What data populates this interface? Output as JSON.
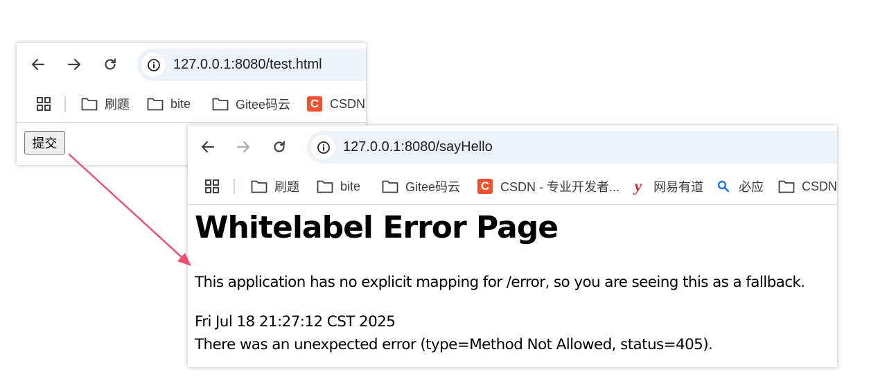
{
  "window_back": {
    "url": "127.0.0.1:8080/test.html",
    "bookmarks": [
      {
        "label": "刷题",
        "icon": "folder-icon"
      },
      {
        "label": "bite",
        "icon": "folder-icon"
      },
      {
        "label": "Gitee码云",
        "icon": "folder-icon"
      },
      {
        "label": "CSDN",
        "icon": "csdn-icon"
      }
    ],
    "submit_label": "提交"
  },
  "window_front": {
    "url": "127.0.0.1:8080/sayHello",
    "bookmarks": [
      {
        "label": "刷题",
        "icon": "folder-icon"
      },
      {
        "label": "bite",
        "icon": "folder-icon"
      },
      {
        "label": "Gitee码云",
        "icon": "folder-icon"
      },
      {
        "label": "CSDN - 专业开发者...",
        "icon": "csdn-icon"
      },
      {
        "label": "网易有道",
        "icon": "youdao-icon"
      },
      {
        "label": "必应",
        "icon": "bing-search-icon"
      },
      {
        "label": "CSDN",
        "icon": "folder-icon"
      }
    ],
    "error": {
      "title": "Whitelabel Error Page",
      "message": "This application has no explicit mapping for /error, so you are seeing this as a fallback.",
      "timestamp": "Fri Jul 18 21:27:12 CST 2025",
      "detail": "There was an unexpected error (type=Method Not Allowed, status=405)."
    }
  },
  "colors": {
    "omnibox_bg": "#edf1f8",
    "arrow": "#f0506e",
    "csdn": "#f0512f",
    "youdao": "#e0263c",
    "bing": "#1a73e8"
  }
}
